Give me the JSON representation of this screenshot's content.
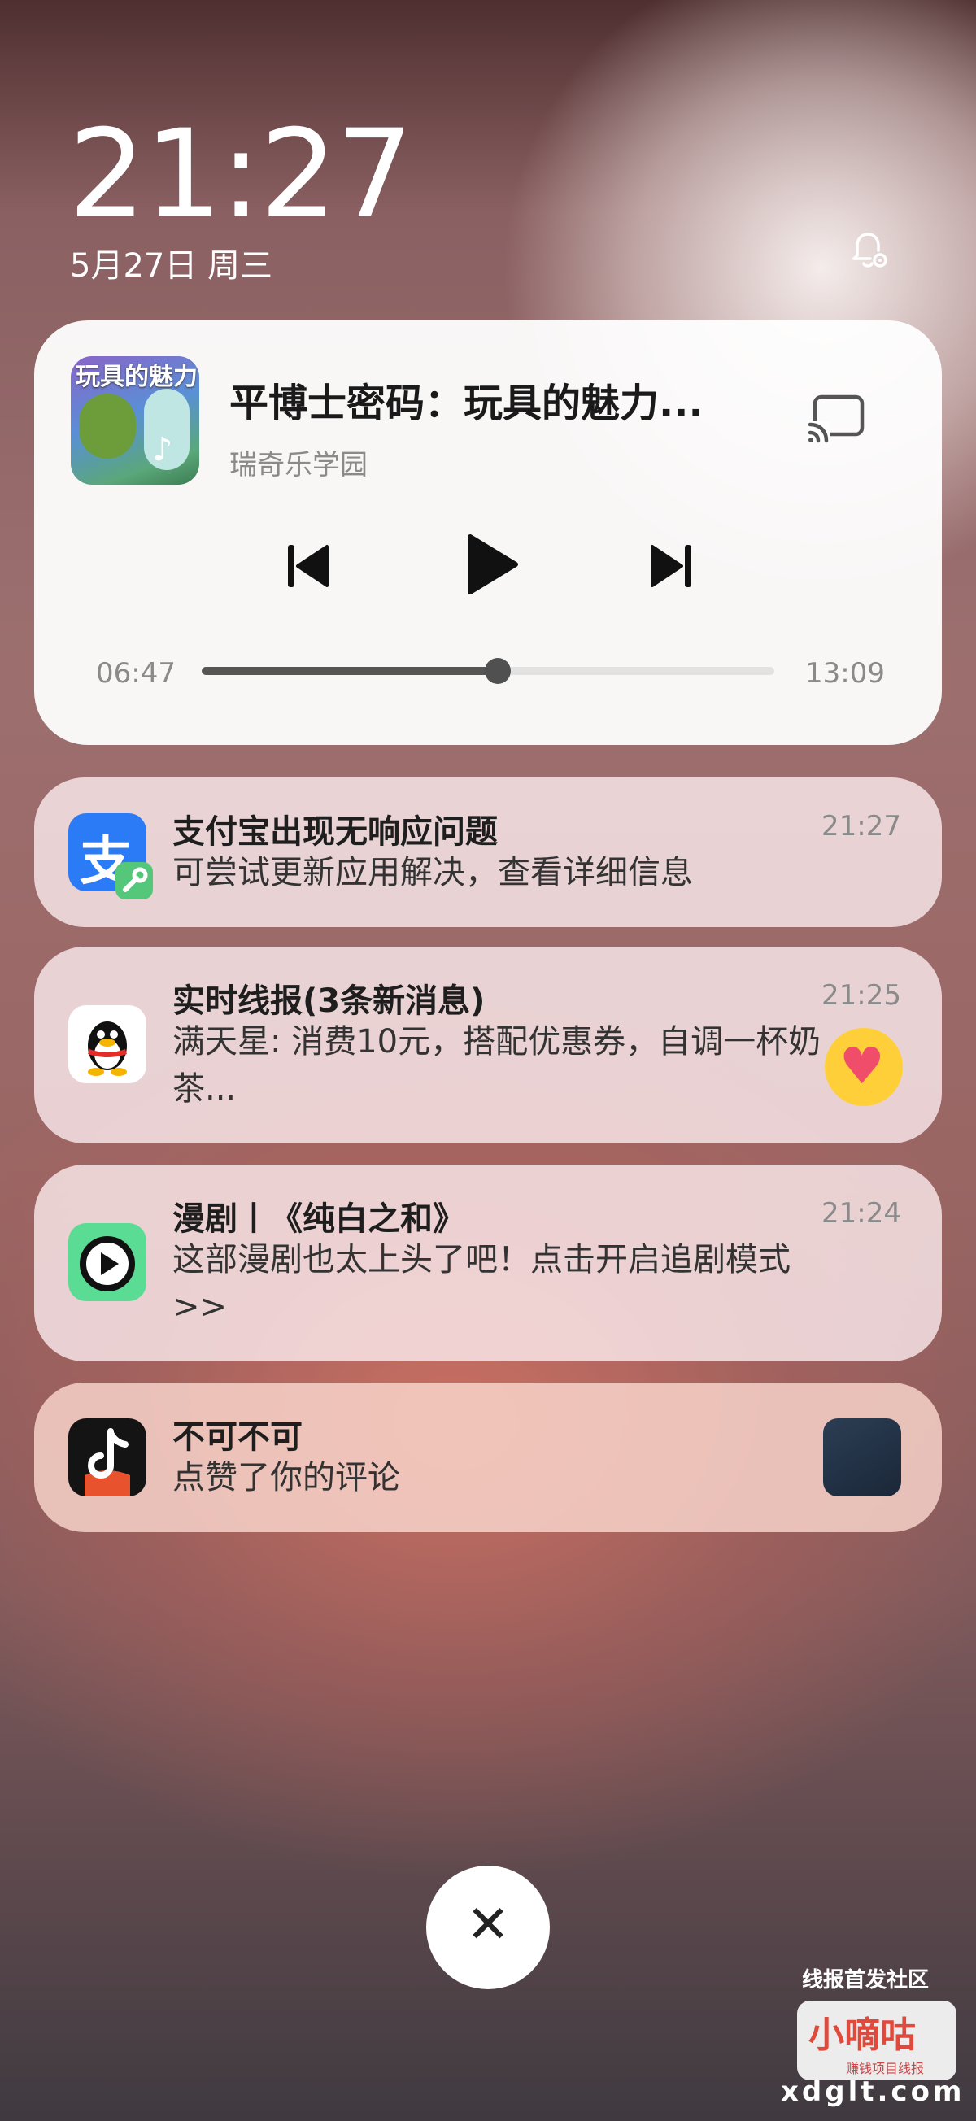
{
  "lockscreen": {
    "time": "21:27",
    "date": "5月27日 周三"
  },
  "media": {
    "thumbnail_text": "玩具的魅力",
    "title": "平博士密码：玩具的魅力...",
    "subtitle": "瑞奇乐学园",
    "elapsed": "06:47",
    "duration": "13:09",
    "progress_fraction": 0.517,
    "icons": [
      "cast-icon",
      "previous-icon",
      "play-icon",
      "next-icon"
    ]
  },
  "notifications": [
    {
      "app_icon": "alipay-icon",
      "title": "支付宝出现无响应问题",
      "time": "21:27",
      "body": "可尝试更新应用解决，查看详细信息"
    },
    {
      "app_icon": "qq-icon",
      "title": "实时线报(3条新消息)",
      "time": "21:25",
      "body": "满天星: 消费10元，搭配优惠券，自调一杯奶茶..."
    },
    {
      "app_icon": "play-circle-app-icon",
      "title": "漫剧丨《纯白之和》",
      "time": "21:24",
      "body": "这部漫剧也太上头了吧！点击开启追剧模式>>"
    },
    {
      "app_icon": "tiktok-icon",
      "title": "不可不可",
      "time": "",
      "body": "点赞了你的评论"
    }
  ],
  "watermark": {
    "top": "线报首发社区",
    "logo": "小嘀咕",
    "sub": "赚钱项目线报",
    "bottom": "xdglt.com"
  },
  "colors": {
    "alipay_blue": "#2a7bf5",
    "tv_green": "#5bdc94",
    "heart_yellow": "#ffcf3a"
  }
}
